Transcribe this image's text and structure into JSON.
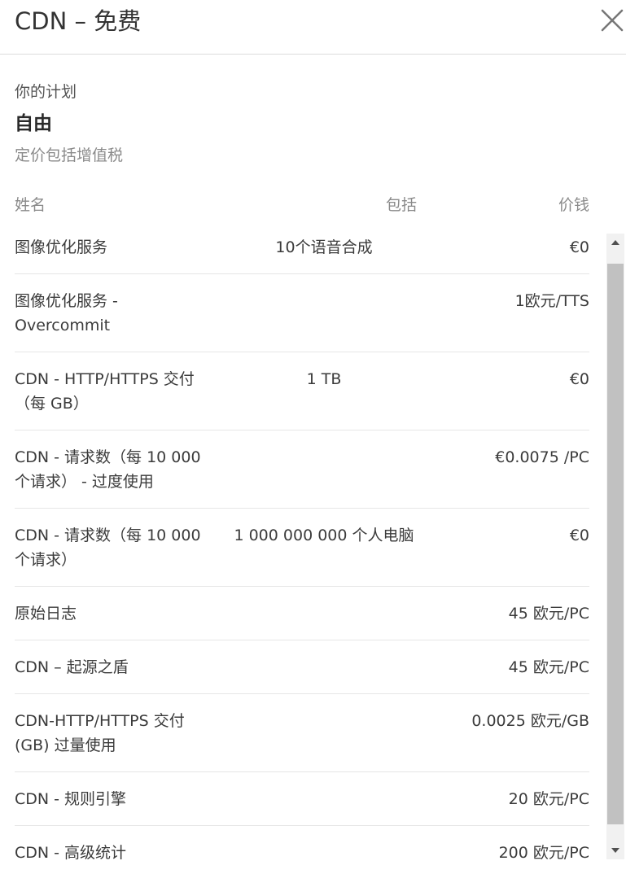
{
  "header": {
    "title": "CDN – 免费",
    "close_icon": "close-icon"
  },
  "plan": {
    "label": "你的计划",
    "name": "自由",
    "note": "定价包括增值税"
  },
  "table": {
    "columns": {
      "name": "姓名",
      "included": "包括",
      "price": "价钱"
    },
    "rows": [
      {
        "name": "图像优化服务",
        "included": "10个语音合成",
        "price": "€0"
      },
      {
        "name": "图像优化服务 - Overcommit",
        "included": "",
        "price": "1欧元/TTS"
      },
      {
        "name": "CDN - HTTP/HTTPS 交付（每 GB）",
        "included": "1 TB",
        "price": "€0"
      },
      {
        "name": "CDN - 请求数（每 10 000 个请求） - 过度使用",
        "included": "",
        "price": "€0.0075 /PC"
      },
      {
        "name": "CDN - 请求数（每 10 000 个请求）",
        "included": "1 000 000 000 个人电脑",
        "price": "€0"
      },
      {
        "name": "原始日志",
        "included": "",
        "price": "45 欧元/PC"
      },
      {
        "name": "CDN – 起源之盾",
        "included": "",
        "price": "45 欧元/PC"
      },
      {
        "name": "CDN-HTTP/HTTPS 交付 (GB) 过量使用",
        "included": "",
        "price": "0.0025 欧元/GB"
      },
      {
        "name": "CDN - 规则引擎",
        "included": "",
        "price": "20 欧元/PC"
      },
      {
        "name": "CDN - 高级统计",
        "included": "",
        "price": "200 欧元/PC"
      }
    ]
  },
  "scrollbar": {
    "up_icon": "triangle-up-icon",
    "down_icon": "triangle-down-icon"
  }
}
